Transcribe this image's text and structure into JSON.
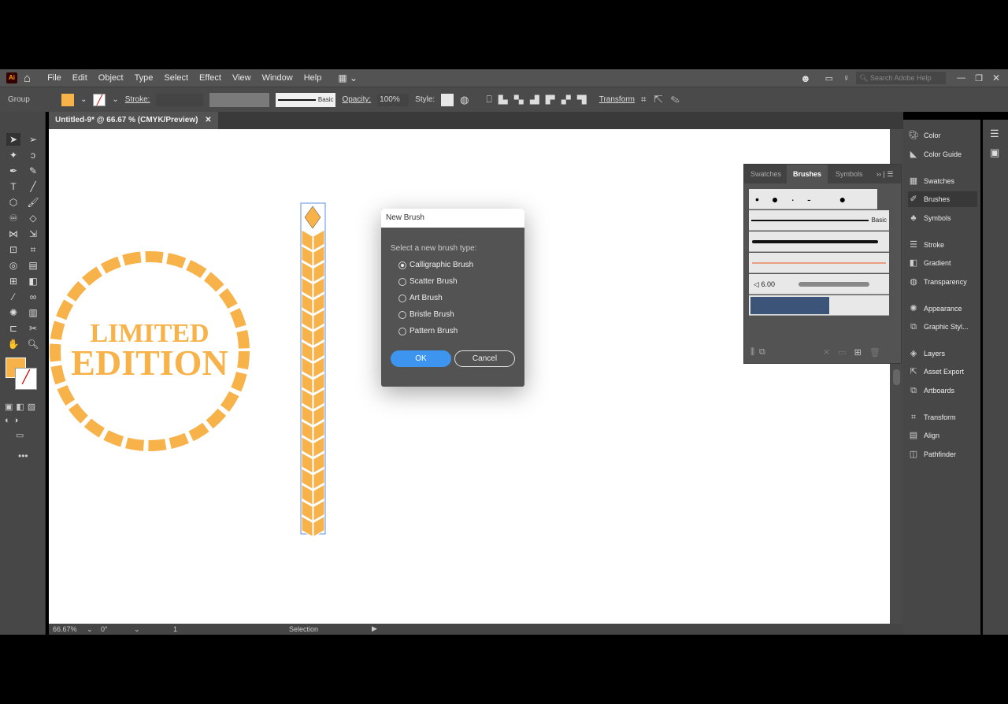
{
  "app": {
    "logo": "Ai",
    "menus": [
      "File",
      "Edit",
      "Object",
      "Type",
      "Select",
      "Effect",
      "View",
      "Window",
      "Help"
    ],
    "search_placeholder": "Search Adobe Help"
  },
  "control": {
    "selection": "Group",
    "stroke_label": "Stroke:",
    "brush": "Basic",
    "opacity_label": "Opacity:",
    "opacity": "100%",
    "style_label": "Style:",
    "transform": "Transform",
    "fill_color": "#F7B24A"
  },
  "document": {
    "tab": "Untitled-9* @ 66.67 % (CMYK/Preview)"
  },
  "artwork": {
    "line1": "LIMITED",
    "line2": "EDITION",
    "color": "#F7B24A"
  },
  "status": {
    "zoom": "66.67%",
    "rotation": "0°",
    "artboard": "1",
    "tool": "Selection"
  },
  "dialog": {
    "title": "New Brush",
    "prompt": "Select a new brush type:",
    "options": [
      "Calligraphic Brush",
      "Scatter Brush",
      "Art Brush",
      "Bristle Brush",
      "Pattern Brush"
    ],
    "selected": 0,
    "ok": "OK",
    "cancel": "Cancel"
  },
  "brushes_panel": {
    "tabs": [
      "Swatches",
      "Brushes",
      "Symbols"
    ],
    "active_tab": "Brushes",
    "basic": "Basic",
    "bristle_size": "6.00"
  },
  "dock": {
    "items": [
      "Color",
      "Color Guide",
      "Swatches",
      "Brushes",
      "Symbols",
      "Stroke",
      "Gradient",
      "Transparency",
      "Appearance",
      "Graphic Styl...",
      "Layers",
      "Asset Export",
      "Artboards",
      "Transform",
      "Align",
      "Pathfinder"
    ],
    "active": "Brushes"
  }
}
